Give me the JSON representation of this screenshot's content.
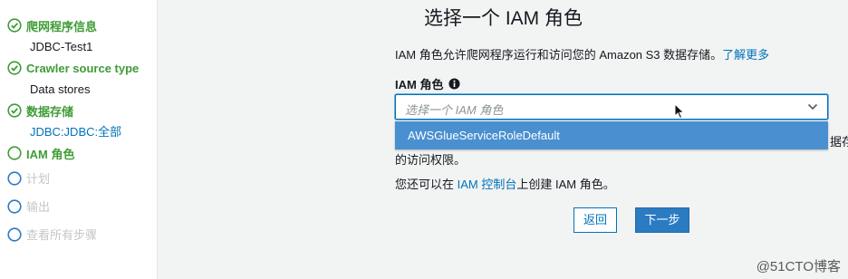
{
  "colors": {
    "complete_green": "#3f9c35",
    "pending_gray": "#c6c6c6",
    "link_blue": "#0073bb",
    "highlight_blue": "#4a90d0",
    "primary_button": "#2b7bc2"
  },
  "sidebar": {
    "steps": [
      {
        "label": "爬网程序信息",
        "sub": "JDBC-Test1",
        "status": "complete",
        "icon": "check-circle-icon"
      },
      {
        "label": "Crawler source type",
        "sub": "Data stores",
        "status": "complete",
        "icon": "check-circle-icon"
      },
      {
        "label": "数据存储",
        "sub": "JDBC:JDBC:全部",
        "status": "complete",
        "icon": "check-circle-icon"
      },
      {
        "label": "IAM 角色",
        "status": "current",
        "icon": "empty-circle-icon"
      },
      {
        "label": "计划",
        "status": "pending",
        "icon": "empty-circle-icon"
      },
      {
        "label": "输出",
        "status": "pending",
        "icon": "empty-circle-icon"
      },
      {
        "label": "查看所有步骤",
        "status": "pending",
        "icon": "empty-circle-icon"
      }
    ]
  },
  "main": {
    "title": "选择一个 IAM 角色",
    "description": "IAM 角色允许爬网程序运行和访问您的 Amazon S3 数据存储。",
    "learn_more": "了解更多",
    "field_label": "IAM 角色",
    "info_icon": "info-icon",
    "select_placeholder": "选择一个 IAM 角色",
    "dropdown_option": "AWSGlueServiceRoleDefault",
    "clipped_right_text": "据存",
    "access_text": "的访问权限。",
    "create_prefix": "您还可以在",
    "create_link": "IAM 控制台",
    "create_suffix": "上创建 IAM 角色。",
    "back_button": "返回",
    "next_button": "下一步"
  },
  "watermark": "@51CTO博客"
}
